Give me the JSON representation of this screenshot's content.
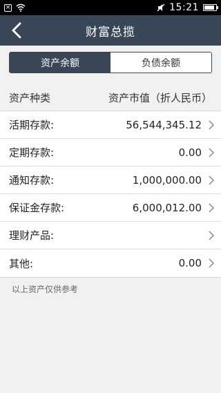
{
  "status_bar": {
    "time": "15:21",
    "battery_level": 0.85,
    "icons": [
      "close-icon",
      "wifi-icon",
      "mute-icon",
      "battery-icon"
    ]
  },
  "nav": {
    "title": "财富总揽",
    "back_icon": "chevron-left-icon"
  },
  "tabs": [
    {
      "label": "资产余额",
      "active": true
    },
    {
      "label": "负债余额",
      "active": false
    }
  ],
  "list_header": {
    "left": "资产种类",
    "right": "资产市值（折人民币）"
  },
  "rows": [
    {
      "label": "活期存款:",
      "value": "56,544,345.12"
    },
    {
      "label": "定期存款:",
      "value": "0.00"
    },
    {
      "label": "通知存款:",
      "value": "1,000,000.00"
    },
    {
      "label": "保证金存款:",
      "value": "6,000,012.00"
    },
    {
      "label": "理财产品:",
      "value": ""
    },
    {
      "label": "其他:",
      "value": "0.00"
    }
  ],
  "footnote": "以上资产仅供参考",
  "colors": {
    "nav_bg": "#394656",
    "page_bg": "#f1f1f1"
  }
}
